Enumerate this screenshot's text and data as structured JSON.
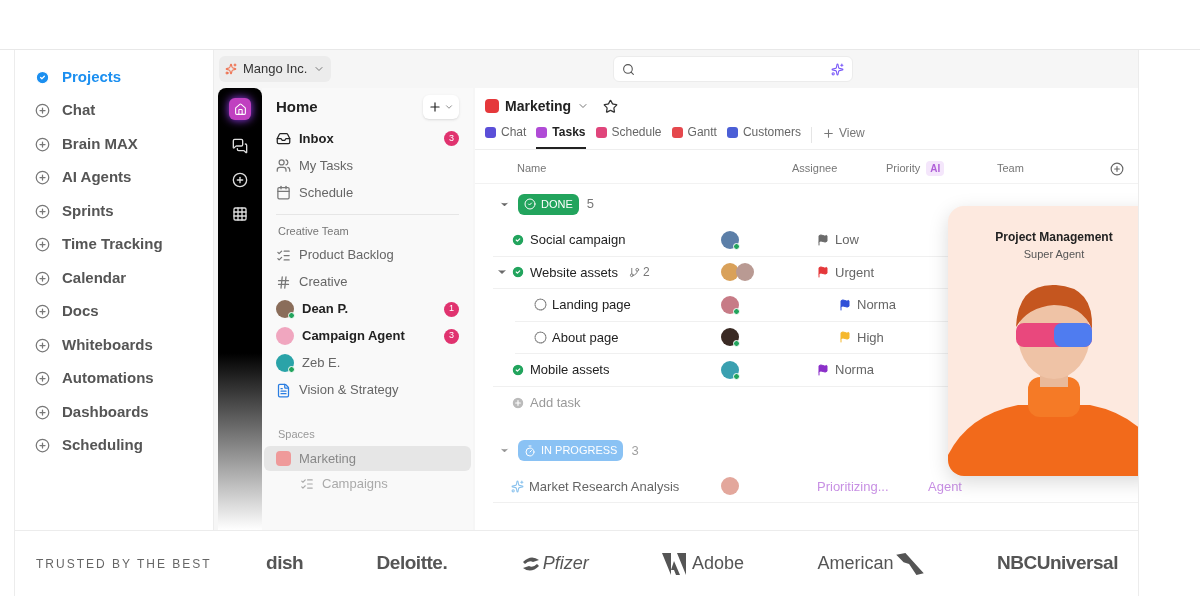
{
  "nav": {
    "items": [
      {
        "label": "Projects",
        "selected": true
      },
      {
        "label": "Chat",
        "selected": false
      },
      {
        "label": "Brain MAX",
        "selected": false
      },
      {
        "label": "AI Agents",
        "selected": false
      },
      {
        "label": "Sprints",
        "selected": false
      },
      {
        "label": "Time Tracking",
        "selected": false
      },
      {
        "label": "Calendar",
        "selected": false
      },
      {
        "label": "Docs",
        "selected": false
      },
      {
        "label": "Whiteboards",
        "selected": false
      },
      {
        "label": "Automations",
        "selected": false
      },
      {
        "label": "Dashboards",
        "selected": false
      },
      {
        "label": "Scheduling",
        "selected": false
      }
    ]
  },
  "app": {
    "workspace": "Mango Inc.",
    "home": {
      "title": "Home",
      "items": [
        {
          "kind": "inbox",
          "label": "Inbox",
          "unread": true,
          "badge": "3"
        },
        {
          "kind": "tasks",
          "label": "My Tasks",
          "unread": false
        },
        {
          "kind": "schedule",
          "label": "Schedule",
          "unread": false
        }
      ],
      "section": "Creative Team",
      "team_items": [
        {
          "kind": "list",
          "label": "Product Backlog",
          "unread": false
        },
        {
          "kind": "channel",
          "label": "Creative",
          "unread": false
        },
        {
          "kind": "person",
          "label": "Dean P.",
          "unread": true,
          "badge": "1",
          "color": "#8a6d5a",
          "online": true
        },
        {
          "kind": "agent",
          "label": "Campaign Agent",
          "unread": true,
          "badge": "3",
          "color": "#f0a6bf",
          "online": false
        },
        {
          "kind": "person",
          "label": "Zeb E.",
          "unread": false,
          "color": "#2aa3a8",
          "online": true
        },
        {
          "kind": "doc",
          "label": "Vision & Strategy",
          "unread": false
        }
      ],
      "spaces_title": "Spaces",
      "spaces": [
        {
          "label": "Marketing",
          "selected": true,
          "children": [
            {
              "label": "Campaigns",
              "selected": false
            }
          ]
        }
      ]
    },
    "main": {
      "title": "Marketing",
      "tabs": [
        {
          "label": "Chat",
          "selected": false,
          "color": "#5b4fd8"
        },
        {
          "label": "Tasks",
          "selected": true,
          "color": "#b04bd6"
        },
        {
          "label": "Schedule",
          "selected": false,
          "color": "#e0457b"
        },
        {
          "label": "Gantt",
          "selected": false,
          "color": "#e5484d"
        },
        {
          "label": "Customers",
          "selected": false,
          "color": "#4b5fd6"
        }
      ],
      "add_view": "View",
      "columns": [
        "Name",
        "Assignee",
        "Priority",
        "Team"
      ],
      "ai_badge": "AI",
      "groups": [
        {
          "status": "DONE",
          "kind": "done",
          "count": "5",
          "expanded": true,
          "faded": false,
          "tasks": [
            {
              "name": "Social campaign",
              "done": true,
              "avatars": [
                {
                  "color": "#5c7fa8"
                }
              ],
              "online": true,
              "priority": "Low",
              "color": "#6b6b6b"
            },
            {
              "name": "Website assets",
              "done": true,
              "subtasks": "2",
              "expanded": true,
              "avatars": [
                {
                  "color": "#d9a15a"
                },
                {
                  "color": "#b99a93"
                }
              ],
              "online": false,
              "priority": "Urgent",
              "color": "#e5383b",
              "children": [
                {
                  "name": "Landing page",
                  "done": false,
                  "avatars": [
                    {
                      "color": "#c77b86"
                    }
                  ],
                  "online": true,
                  "priority": "Norma",
                  "color": "#2f4fd8"
                },
                {
                  "name": "About page",
                  "done": false,
                  "avatars": [
                    {
                      "color": "#3a2a24"
                    }
                  ],
                  "online": true,
                  "priority": "High",
                  "color": "#f5b82e"
                }
              ]
            },
            {
              "name": "Mobile assets",
              "done": true,
              "avatars": [
                {
                  "color": "#3aa0b0"
                }
              ],
              "online": true,
              "priority": "Norma",
              "color": "#8b2fc9"
            }
          ],
          "add_task": "Add task"
        },
        {
          "status": "IN PROGRESS",
          "kind": "progress",
          "count": "3",
          "expanded": true,
          "faded": true,
          "tasks": [
            {
              "name": "Market Research Analysis",
              "agent": true,
              "avatars": [
                {
                  "color": "#e3a79c"
                }
              ],
              "online": false,
              "priority": "Prioritizing...",
              "team": "Agent"
            }
          ]
        }
      ]
    },
    "card": {
      "title": "Project Management",
      "subtitle": "Super Agent"
    }
  },
  "footer": {
    "label": "TRUSTED BY THE BEST",
    "logos": [
      {
        "name": "dish",
        "kind": "word"
      },
      {
        "name": "Deloitte.",
        "kind": "word"
      },
      {
        "name": "Pfizer",
        "kind": "pfizer"
      },
      {
        "name": "Adobe",
        "kind": "adobe"
      },
      {
        "name": "American",
        "kind": "american"
      },
      {
        "name": "NBCUniversal",
        "kind": "word"
      }
    ]
  }
}
